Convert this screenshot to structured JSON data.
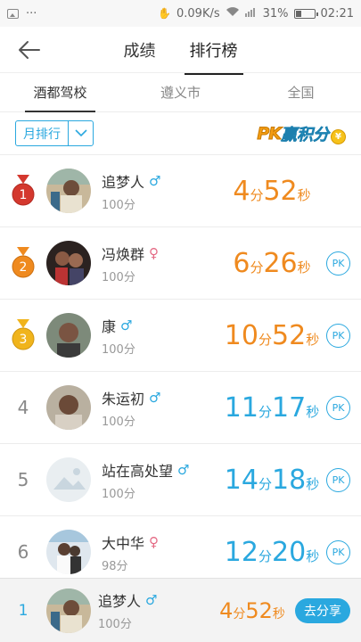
{
  "status": {
    "net_speed": "0.09K/s",
    "battery": "31%",
    "time": "02:21",
    "dots": "···"
  },
  "header": {
    "tabs": [
      "成绩",
      "排行榜"
    ],
    "active_tab": 1
  },
  "subtabs": [
    "酒都驾校",
    "遵义市",
    "全国"
  ],
  "filter": {
    "month_label": "月排行",
    "pk_badge": {
      "pk": "PK",
      "rest": "赢积分",
      "coin": "¥"
    }
  },
  "units": {
    "min": "分",
    "sec": "秒",
    "pk": "PK"
  },
  "rows": [
    {
      "rank": "1",
      "medal": "gold-red",
      "name": "追梦人",
      "gender": "♂",
      "gender_type": "male",
      "score": "100分",
      "min": "4",
      "sec": "52",
      "color": "orange",
      "pk": false
    },
    {
      "rank": "2",
      "medal": "orange",
      "name": "冯焕群",
      "gender": "♀",
      "gender_type": "female",
      "score": "100分",
      "min": "6",
      "sec": "26",
      "color": "orange",
      "pk": true
    },
    {
      "rank": "3",
      "medal": "gold",
      "name": "康",
      "gender": "♂",
      "gender_type": "male",
      "score": "100分",
      "min": "10",
      "sec": "52",
      "color": "orange",
      "pk": true
    },
    {
      "rank": "4",
      "medal": "",
      "name": "朱运初",
      "gender": "♂",
      "gender_type": "male",
      "score": "100分",
      "min": "11",
      "sec": "17",
      "color": "blue",
      "pk": true
    },
    {
      "rank": "5",
      "medal": "",
      "name": "站在高处望",
      "gender": "♂",
      "gender_type": "male",
      "score": "100分",
      "min": "14",
      "sec": "18",
      "color": "blue",
      "pk": true
    },
    {
      "rank": "6",
      "medal": "",
      "name": "大中华",
      "gender": "♀",
      "gender_type": "female",
      "score": "98分",
      "min": "12",
      "sec": "20",
      "color": "blue",
      "pk": true
    }
  ],
  "me": {
    "rank": "1",
    "name": "追梦人",
    "gender": "♂",
    "score": "100分",
    "min": "4",
    "sec": "52",
    "share_label": "去分享"
  },
  "colors": {
    "accent_blue": "#2aa8df",
    "time_orange": "#ef8a1f",
    "female_pink": "#e46a84"
  }
}
